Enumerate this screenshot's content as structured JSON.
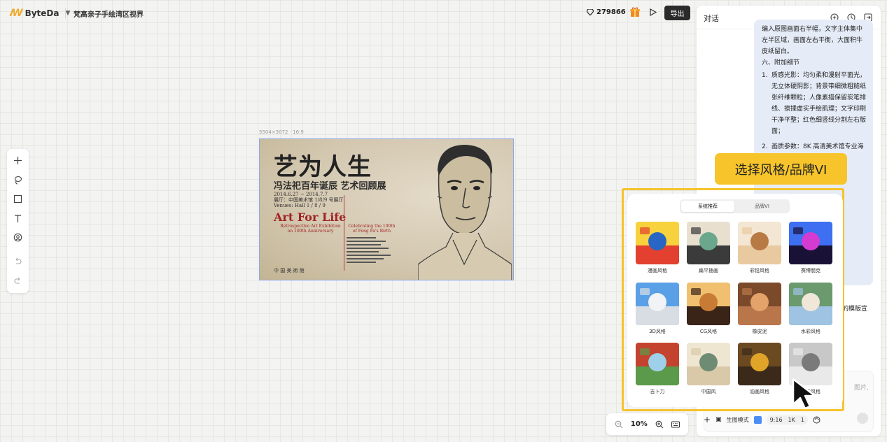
{
  "topbar": {
    "brand": "ByteDa",
    "project_title": "梵高亲子手绘湾区视界",
    "credits": "279866",
    "export_label": "导出"
  },
  "canvas": {
    "dims": "5504×3072 · 16:9",
    "poster": {
      "title": "艺为人生",
      "subtitle": "冯法祀百年诞辰 艺术回顾展",
      "info": "2014.6.27 ~ 2014.7.7\n展厅：中国美术馆 1/8/9 号展厅\nVenues: Hall 1 / 8 / 9",
      "en_title": "Art For Life",
      "en_sub1": "Retrospective Art Exhibition on 100th Anniversary",
      "en_sub2": "Celebrating the 100th of Feng Fa's Birth",
      "seal": "中 国 美 術 館"
    }
  },
  "zoom": {
    "value": "10%"
  },
  "panel": {
    "title": "对话",
    "msg_intro": "编入原图画面右半幅，文字主体集中左半区域，画面左右平衡，大面积牛皮纸留白。",
    "msg_heading": "六、附加细节",
    "msg_items": [
      {
        "num": "1.",
        "text": "质感光影：均匀柔和漫射平面光，无立体硬阴影；背景带细微粗糙纸张纤维颗粒；人像素描保留炭笔排线、擦揉虚实手绘肌理；文字印刷干净平整；红色细竖线分割左右版面；"
      },
      {
        "num": "2.",
        "text": "画质参数：8K 高清美术馆专业海"
      }
    ],
    "frag1": "的模版宣",
    "frag2": "图片,",
    "input_bar": {
      "mode_label": "生图模式",
      "ratio": "9:16",
      "resolution": "1K",
      "count": "1"
    }
  },
  "callout": {
    "text": "选择风格/品牌VI"
  },
  "style_picker": {
    "tabs": [
      "系统推荐",
      "品牌VI"
    ],
    "active_tab": 0,
    "styles": [
      {
        "label": "漫画风格",
        "colors": [
          "#e3402f",
          "#2766c4",
          "#f7d23c"
        ]
      },
      {
        "label": "扁平插画",
        "colors": [
          "#3b3b3b",
          "#6aa78c",
          "#e8dfcf"
        ]
      },
      {
        "label": "彩铅风格",
        "colors": [
          "#e9c9a0",
          "#b87a45",
          "#f3e6d3"
        ]
      },
      {
        "label": "赛博朋克",
        "colors": [
          "#1a1236",
          "#d33bd1",
          "#3e6ff0"
        ]
      },
      {
        "label": "3D风格",
        "colors": [
          "#d8dde4",
          "#f1f3f6",
          "#5aa0e6"
        ]
      },
      {
        "label": "CG风格",
        "colors": [
          "#3a2418",
          "#c77b34",
          "#f0c070"
        ]
      },
      {
        "label": "橡皮泥",
        "colors": [
          "#b9764a",
          "#e3a36b",
          "#7a4a2a"
        ]
      },
      {
        "label": "水彩风格",
        "colors": [
          "#9fc3e2",
          "#f0e7d8",
          "#6b9a6f"
        ]
      },
      {
        "label": "吉卜力",
        "colors": [
          "#5a9a4a",
          "#9fd0ea",
          "#c4432f"
        ]
      },
      {
        "label": "中国风",
        "colors": [
          "#d9c9a8",
          "#6e8c74",
          "#efe6d2"
        ]
      },
      {
        "label": "油画风格",
        "colors": [
          "#3b2a1a",
          "#e0a528",
          "#6b4a22"
        ]
      },
      {
        "label": "墨画风格",
        "colors": [
          "#e9e9e9",
          "#7a7a7a",
          "#c8c8c8"
        ]
      }
    ]
  }
}
